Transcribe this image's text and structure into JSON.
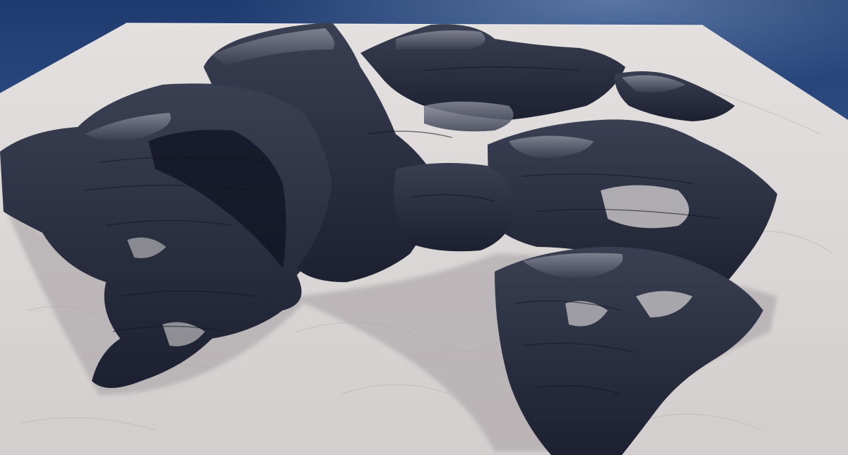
{
  "scene": {
    "name": "terrain-render",
    "colors": {
      "sky_top": "#1f3a6e",
      "sky_mid": "#3a5d96",
      "sky_glow": "#8aa6cf",
      "plane_light": "#e4e0df",
      "plane_mid": "#d3cece",
      "rock_dark": "#1c2030",
      "rock_mid": "#3a3f52",
      "rock_light": "#8a8c99",
      "snow": "#d9d5d6"
    }
  }
}
